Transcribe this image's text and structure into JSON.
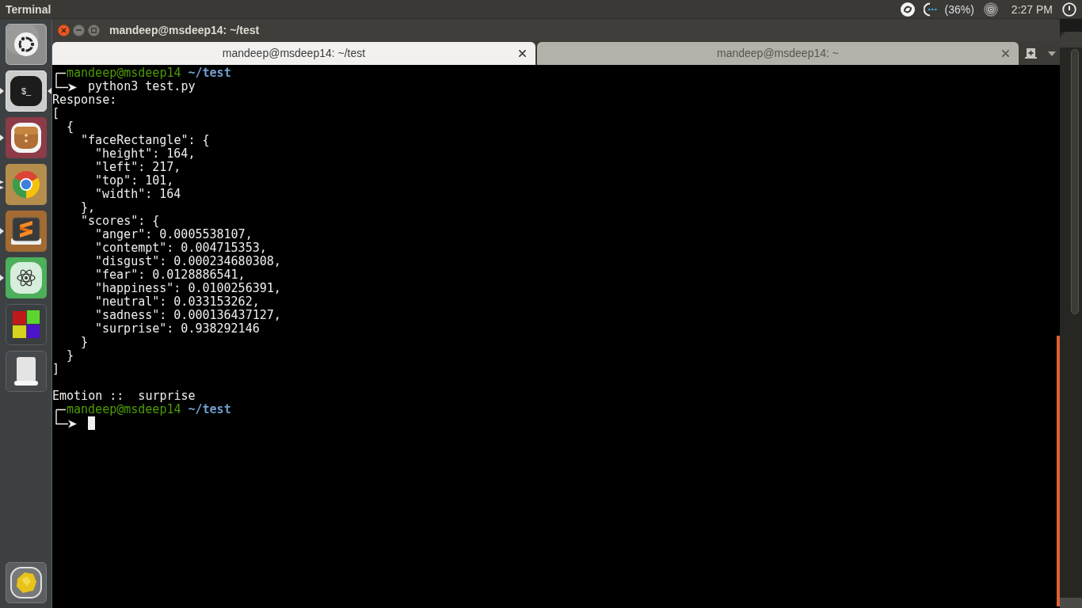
{
  "top_panel": {
    "title": "Terminal",
    "battery": "(36%)",
    "clock": "2:27 PM"
  },
  "launcher": {
    "items": [
      {
        "kind": "dash",
        "running": false,
        "focused": false
      },
      {
        "kind": "terminal",
        "glyph": "$_",
        "running": true,
        "multiple_windows": false,
        "focused": true
      },
      {
        "kind": "archive",
        "running": true,
        "multiple_windows": false,
        "focused": false
      },
      {
        "kind": "browser",
        "running": true,
        "multiple_windows": true,
        "focused": false
      },
      {
        "kind": "editor",
        "running": true,
        "multiple_windows": false,
        "focused": false
      },
      {
        "kind": "atom",
        "running": true,
        "multiple_windows": false,
        "focused": false
      },
      {
        "kind": "cubes",
        "running": false,
        "focused": false
      },
      {
        "kind": "drive",
        "running": false,
        "focused": false
      }
    ],
    "bottom_items": [
      {
        "kind": "crumpled",
        "running": false,
        "focused": false
      }
    ]
  },
  "window": {
    "title": "mandeep@msdeep14: ~/test"
  },
  "tabs": [
    {
      "label": "mandeep@msdeep14: ~/test",
      "selected": true
    },
    {
      "label": "mandeep@msdeep14: ~",
      "selected": false
    }
  ],
  "terminal": {
    "blocks": [
      {
        "kind": "prompt",
        "user_host": "mandeep@msdeep14",
        "path": "~/test",
        "command": "python3 test.py",
        "cursor": false
      },
      {
        "kind": "output",
        "text": "Response:"
      },
      {
        "kind": "output",
        "text": "[",
        "children": [
          {
            "text": "{",
            "children": [
              {
                "text": "\"faceRectangle\": {",
                "children": [
                  {
                    "text": "\"height\": 164,"
                  },
                  {
                    "text": "\"left\": 217,"
                  },
                  {
                    "text": "\"top\": 101,"
                  },
                  {
                    "text": "\"width\": 164"
                  }
                ],
                "close": "},"
              },
              {
                "text": "\"scores\": {",
                "children": [
                  {
                    "text": "\"anger\": 0.0005538107,"
                  },
                  {
                    "text": "\"contempt\": 0.004715353,"
                  },
                  {
                    "text": "\"disgust\": 0.000234680308,"
                  },
                  {
                    "text": "\"fear\": 0.0128886541,"
                  },
                  {
                    "text": "\"happiness\": 0.0100256391,"
                  },
                  {
                    "text": "\"neutral\": 0.033153262,"
                  },
                  {
                    "text": "\"sadness\": 0.000136437127,"
                  },
                  {
                    "text": "\"surprise\": 0.938292146"
                  }
                ],
                "close": "}"
              }
            ],
            "close": "}"
          }
        ],
        "close": "]"
      },
      {
        "kind": "blank"
      },
      {
        "kind": "output",
        "text": "Emotion ::  surprise"
      },
      {
        "kind": "prompt",
        "user_host": "mandeep@msdeep14",
        "path": "~/test",
        "cursor": true
      }
    ]
  }
}
